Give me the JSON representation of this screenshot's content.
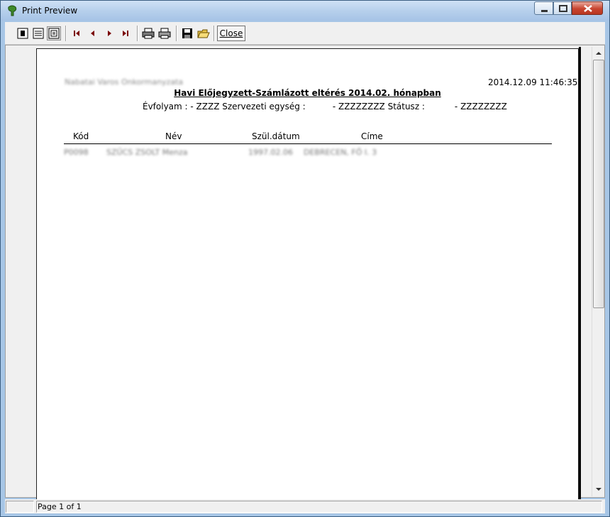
{
  "window": {
    "title": "Print Preview"
  },
  "toolbar": {
    "buttons": [
      {
        "name": "one-page-icon"
      },
      {
        "name": "page-width-icon"
      },
      {
        "name": "whole-page-icon"
      },
      {
        "name": "first-page-icon"
      },
      {
        "name": "prev-page-icon"
      },
      {
        "name": "next-page-icon"
      },
      {
        "name": "last-page-icon"
      },
      {
        "name": "print-setup-icon"
      },
      {
        "name": "print-icon"
      },
      {
        "name": "save-icon"
      },
      {
        "name": "open-icon"
      }
    ],
    "close_label": "Close"
  },
  "report": {
    "org_name": "Nabatai Varos Onkormanyzata",
    "datetime": "2014.12.09 11:46:35",
    "title": "Havi Előjegyzett-Számlázott eltérés 2014.02. hónapban",
    "filter_line": "Évfolyam : - ZZZZ Szervezeti egység :          - ZZZZZZZZ Státusz :           - ZZZZZZZZ",
    "columns": {
      "kod": "Kód",
      "nev": "Név",
      "szul": "Szül.dátum",
      "cime": "Címe"
    },
    "rows": [
      {
        "kod": "P0098",
        "nev": "SZŰCS ZSOLT Menza",
        "szul": "1997.02.06",
        "cime": "DEBRECEN, FŐ I. 3"
      }
    ]
  },
  "status": {
    "page_text": "Page 1 of 1"
  },
  "colors": {
    "titlebar": "#b7d0ec",
    "close_button": "#c8442f",
    "toolbar": "#f0f0f0"
  }
}
